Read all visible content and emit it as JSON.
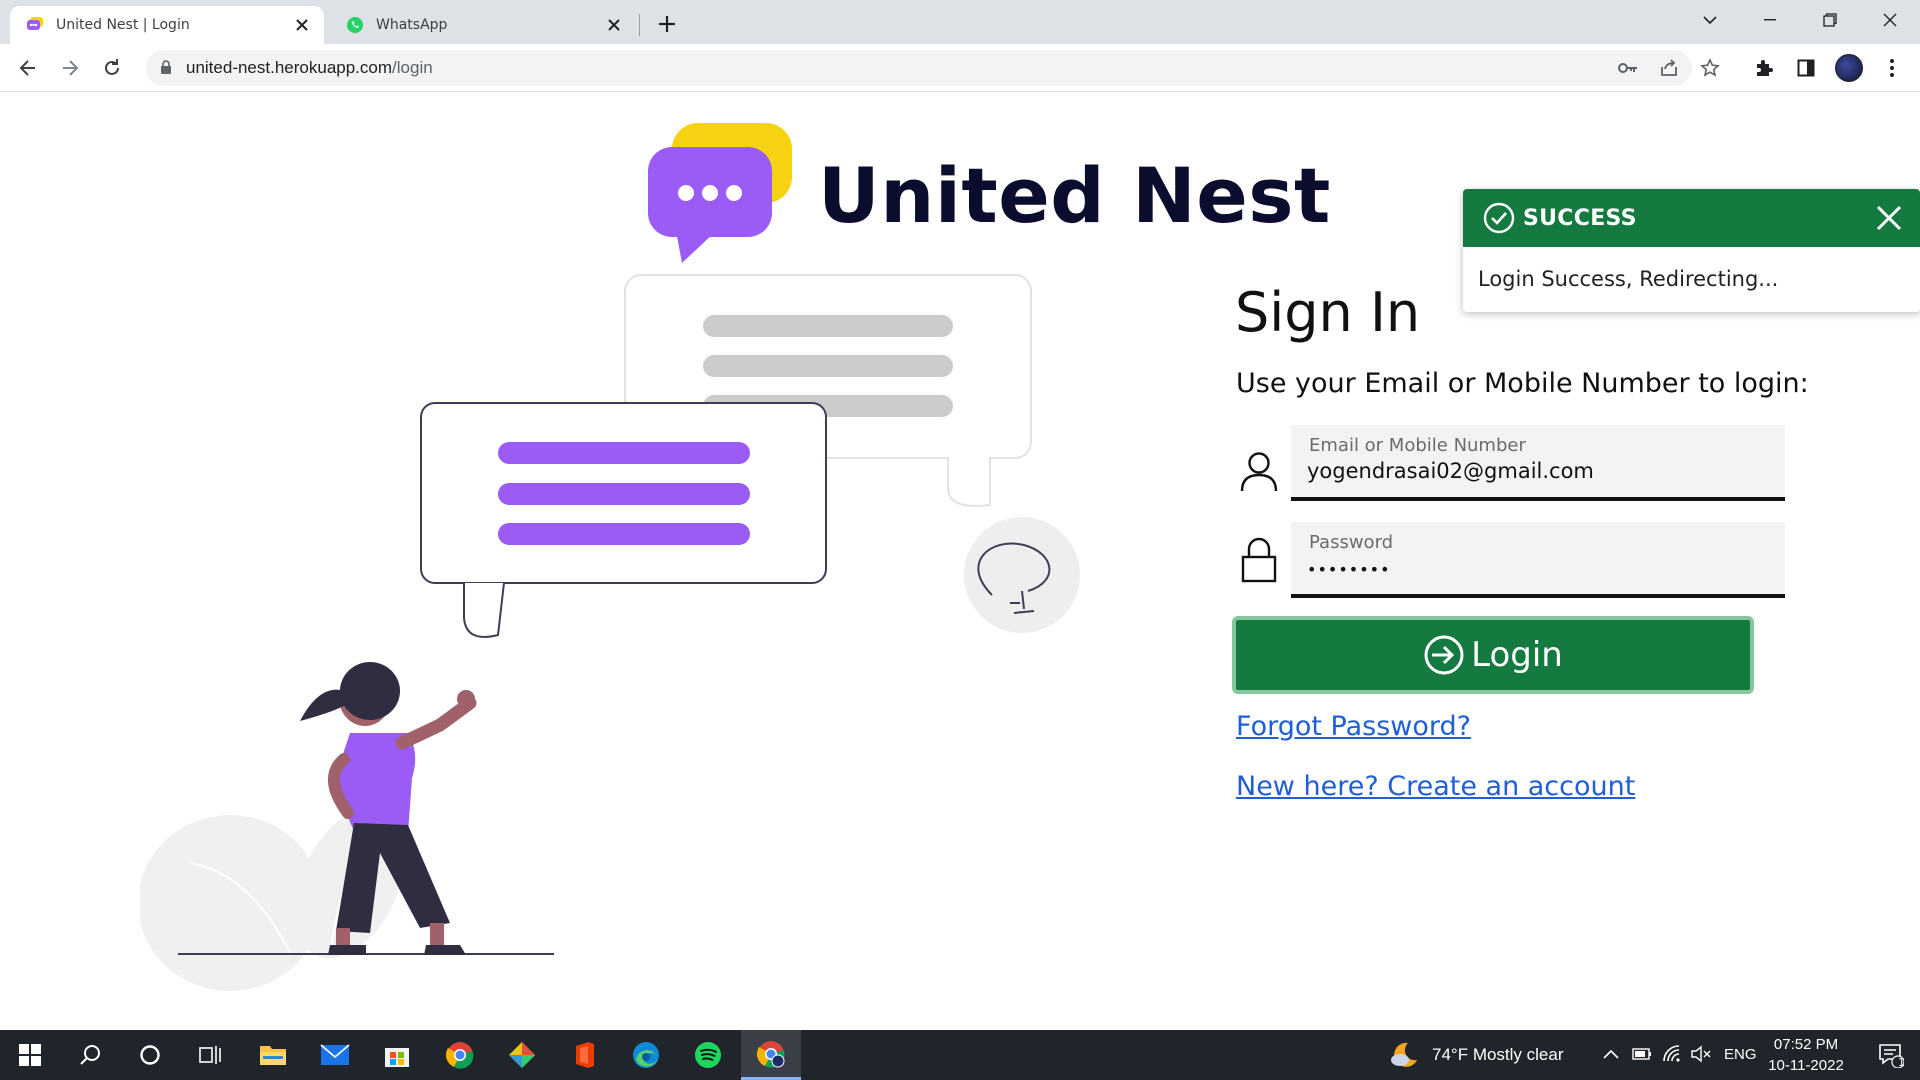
{
  "browser": {
    "tabs": [
      {
        "title": "United Nest | Login",
        "active": true
      },
      {
        "title": "WhatsApp",
        "active": false
      }
    ],
    "url_host": "united-nest.herokuapp.com",
    "url_path": "/login"
  },
  "page": {
    "brand": "United Nest",
    "signin_title": "Sign In",
    "signin_subtitle": "Use your Email or Mobile Number to login:",
    "email_label": "Email or Mobile Number",
    "email_value": "yogendrasai02@gmail.com",
    "password_label": "Password",
    "password_value": "••••••••",
    "login_label": "Login",
    "forgot_link": "Forgot Password?",
    "create_link": "New here? Create an account"
  },
  "toast": {
    "title": "SUCCESS",
    "message": "Login Success, Redirecting..."
  },
  "taskbar": {
    "weather": "74°F  Mostly clear",
    "language": "ENG",
    "time": "07:52 PM",
    "date": "10-11-2022",
    "notification_count": "1"
  },
  "colors": {
    "brand_purple": "#9b5cf6",
    "success_green": "#157a3f",
    "logo_yellow": "#f5d312",
    "link_blue": "#1f5fd6"
  }
}
